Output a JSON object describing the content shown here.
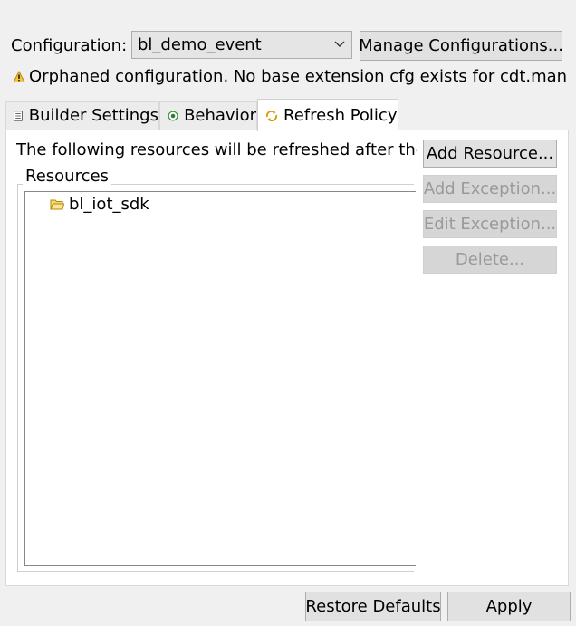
{
  "configuration": {
    "label": "Configuration:",
    "selected": "bl_demo_event",
    "manage_button": "Manage Configurations..."
  },
  "warning": {
    "icon": "warning-icon",
    "text": "Orphaned configuration. No base extension cfg exists for cdt.manag"
  },
  "tabs": [
    {
      "label": "Builder Settings",
      "icon": "list-icon"
    },
    {
      "label": "Behavior",
      "icon": "radio-icon"
    },
    {
      "label": "Refresh Policy",
      "icon": "refresh-icon",
      "active": true
    }
  ],
  "refresh_policy": {
    "description": "The following resources will be refreshed after the p",
    "group_label": "Resources",
    "resources": [
      {
        "name": "bl_iot_sdk",
        "icon": "folder-icon"
      }
    ],
    "buttons": {
      "add_resource": "Add Resource...",
      "add_exception": "Add Exception...",
      "edit_exception": "Edit Exception...",
      "delete": "Delete..."
    }
  },
  "footer": {
    "restore_defaults": "Restore Defaults",
    "apply": "Apply"
  }
}
